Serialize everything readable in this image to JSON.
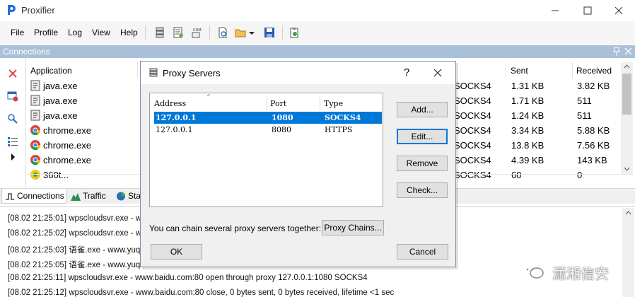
{
  "window": {
    "title": "Proxifier"
  },
  "menu": [
    "File",
    "Profile",
    "Log",
    "View",
    "Help"
  ],
  "connections_panel": {
    "title": "Connections",
    "columns": {
      "application": "Application",
      "sent": "Sent",
      "received": "Received"
    },
    "rows": [
      {
        "app": "java.exe",
        "icon": "java-icon",
        "proto": "SOCKS4",
        "sent": "1.31 KB",
        "received": "3.82 KB"
      },
      {
        "app": "java.exe",
        "icon": "java-icon",
        "proto": "SOCKS4",
        "sent": "1.71 KB",
        "received": "511"
      },
      {
        "app": "java.exe",
        "icon": "java-icon",
        "proto": "SOCKS4",
        "sent": "1.24 KB",
        "received": "511"
      },
      {
        "app": "chrome.exe",
        "icon": "chrome-icon",
        "proto": "SOCKS4",
        "sent": "3.34 KB",
        "received": "5.88 KB"
      },
      {
        "app": "chrome.exe",
        "icon": "chrome-icon",
        "proto": "SOCKS4",
        "sent": "13.8 KB",
        "received": "7.56 KB"
      },
      {
        "app": "chrome.exe",
        "icon": "chrome-icon",
        "proto": "SOCKS4",
        "sent": "4.39 KB",
        "received": "143 KB"
      },
      {
        "app": "360t...",
        "icon": "360-icon",
        "proto": "SOCKS4",
        "sent": "60",
        "received": "0"
      }
    ]
  },
  "tabs": [
    {
      "label": "Connections",
      "icon": "connections-icon"
    },
    {
      "label": "Traffic",
      "icon": "traffic-icon"
    },
    {
      "label": "Stat",
      "icon": "statistics-icon"
    }
  ],
  "log": [
    "[08.02 21:25:01] wpscloudsvr.exe - www",
    "[08.02 21:25:02] wpscloudsvr.exe - www",
    "[08.02 21:25:03] 语雀.exe - www.yuque.c",
    "[08.02 21:25:05] 语雀.exe - www.yuque.c",
    "[08.02 21:25:11] wpscloudsvr.exe - www.baidu.com:80 open through proxy 127.0.0.1:1080 SOCKS4",
    "[08.02 21:25:12] wpscloudsvr.exe - www.baidu.com:80 close, 0 bytes sent, 0 bytes received, lifetime <1 sec"
  ],
  "dialog": {
    "title": "Proxy Servers",
    "help": "?",
    "columns": {
      "address": "Address",
      "port": "Port",
      "type": "Type"
    },
    "servers": [
      {
        "address": "127.0.0.1",
        "port": "1080",
        "type": "SOCKS4",
        "selected": true
      },
      {
        "address": "127.0.0.1",
        "port": "8080",
        "type": "HTTPS",
        "selected": false
      }
    ],
    "buttons": {
      "add": "Add...",
      "edit": "Edit...",
      "remove": "Remove",
      "check": "Check...",
      "chains": "Proxy Chains...",
      "ok": "OK",
      "cancel": "Cancel"
    },
    "chain_text": "You can chain several proxy servers together:"
  },
  "watermark": {
    "text": "潇湘信安"
  },
  "colors": {
    "selection": "#0078d7",
    "panel_header": "#aac0d8",
    "close_red": "#e81123"
  }
}
